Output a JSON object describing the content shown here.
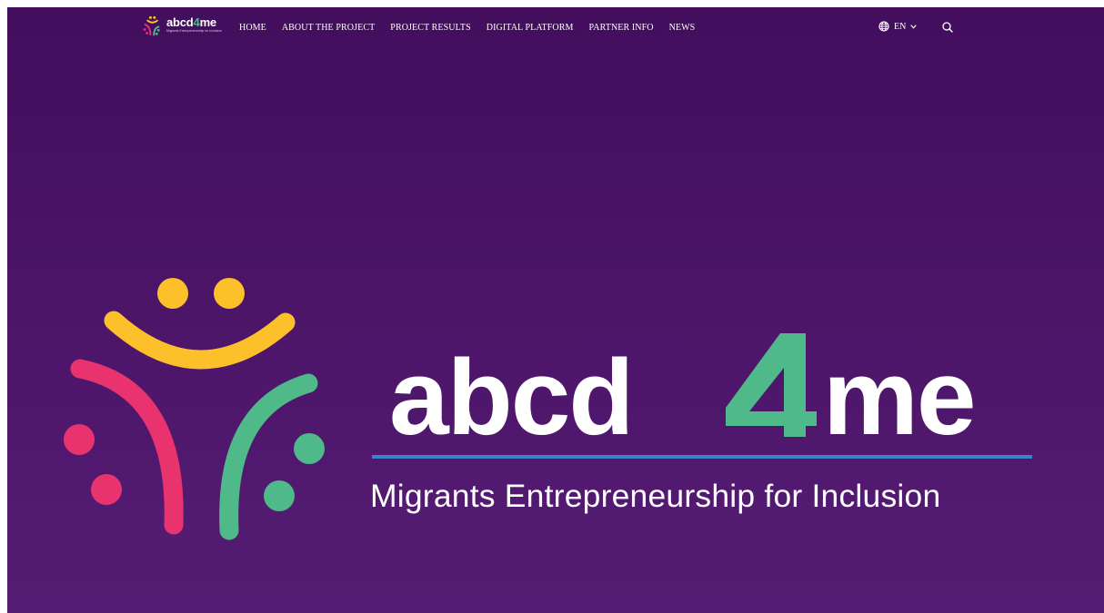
{
  "brand": {
    "name_part1": "abcd",
    "name_part2": "4",
    "name_part3": "me",
    "tagline": "Migrants Entrepreneurship for Inclusion"
  },
  "nav": {
    "items": [
      {
        "label": "HOME"
      },
      {
        "label": "ABOUT THE PROJECT"
      },
      {
        "label": "PROJECT RESULTS"
      },
      {
        "label": "DIGITAL PLATFORM"
      },
      {
        "label": "PARTNER INFO"
      },
      {
        "label": "NEWS"
      }
    ]
  },
  "language": {
    "current": "EN",
    "icon": "globe-icon",
    "dropdown_icon": "chevron-down-icon"
  },
  "search": {
    "icon": "search-icon"
  },
  "hero": {
    "wordmark_left": "abcd",
    "wordmark_digit": "4",
    "wordmark_right": "me",
    "tagline": "Migrants Entrepreneurship for Inclusion"
  },
  "colors": {
    "background_top": "#430e5e",
    "background_bottom": "#551c74",
    "yellow": "#fcc12a",
    "pink": "#e8336f",
    "green": "#4fb98a",
    "blue_rule": "#3a84c9",
    "text": "#ffffff"
  }
}
